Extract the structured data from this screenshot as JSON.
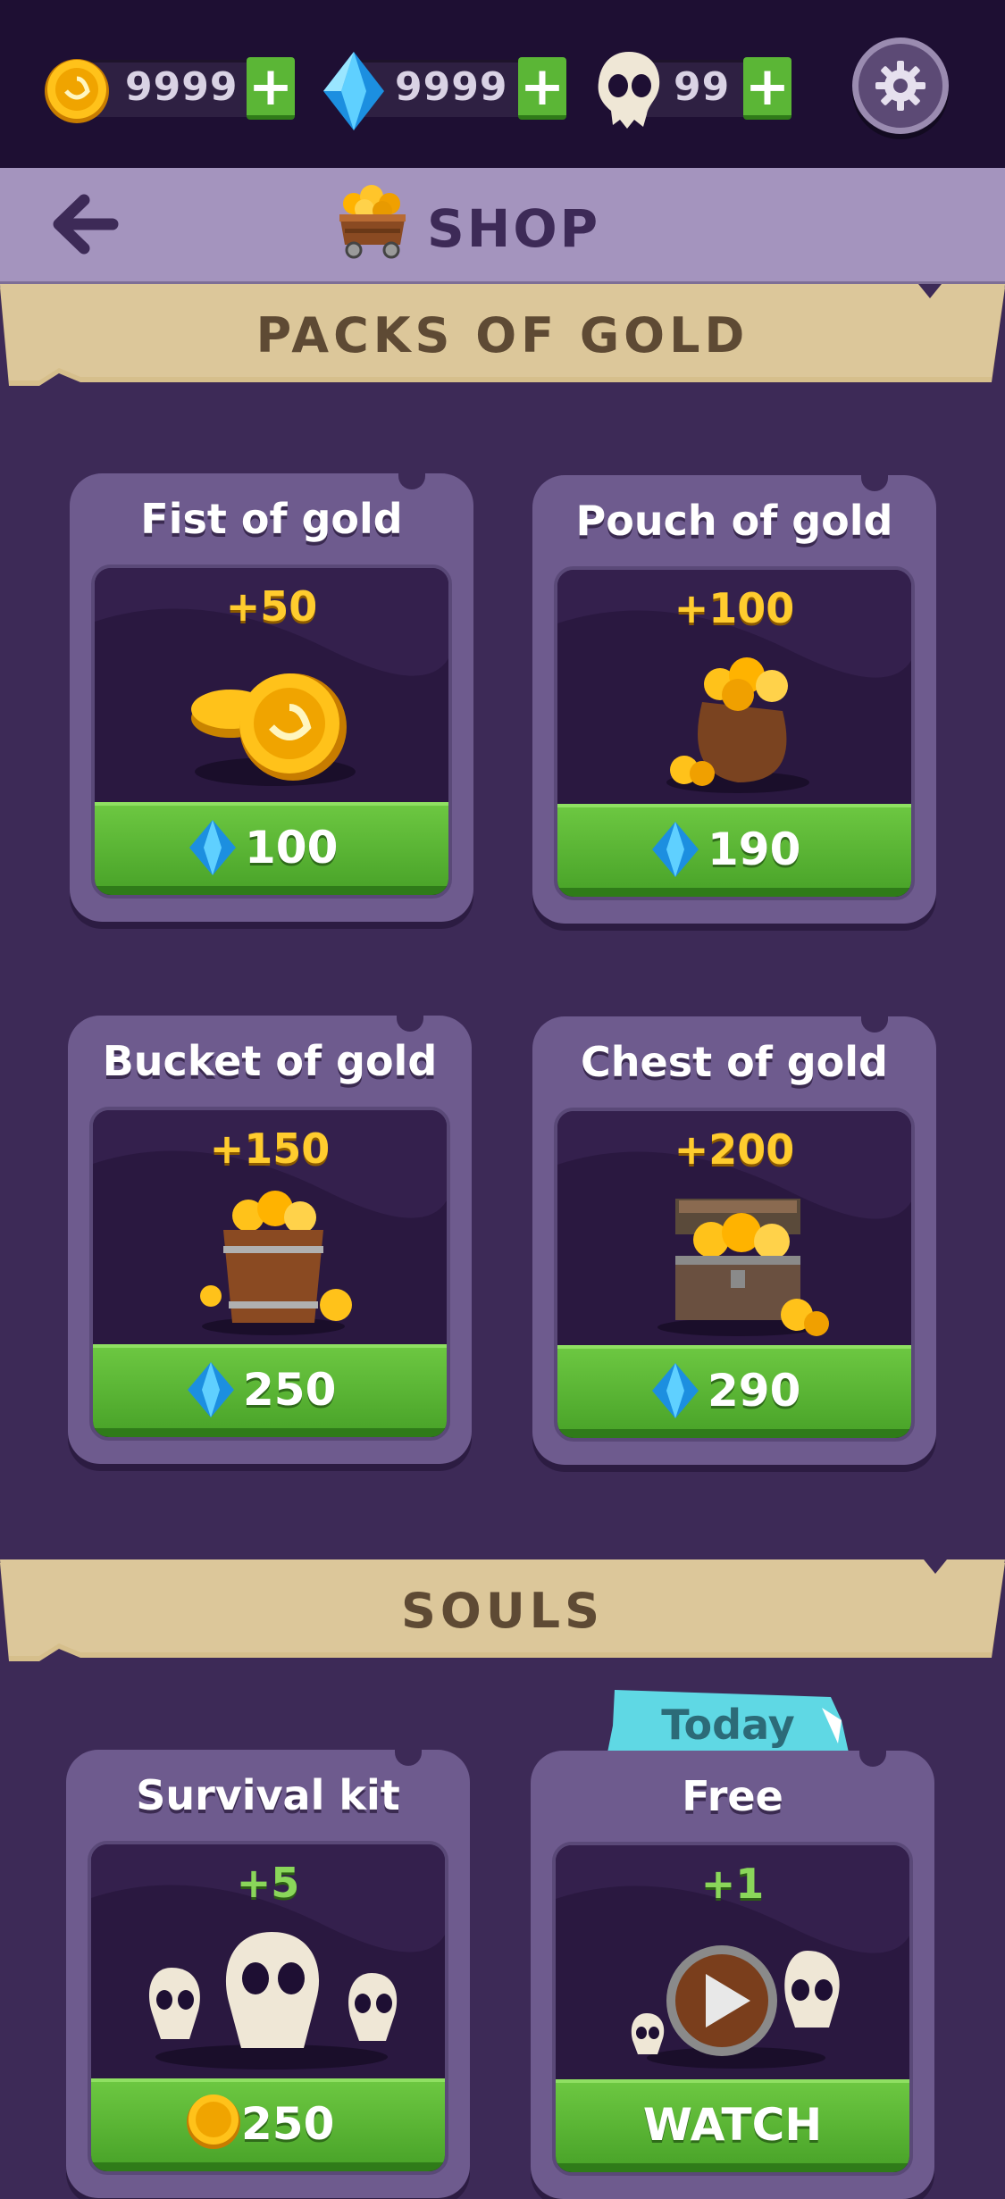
{
  "resources": {
    "gold": {
      "value": "9999",
      "icon": "gold-coin-icon"
    },
    "gems": {
      "value": "9999",
      "icon": "blue-gem-icon"
    },
    "souls": {
      "value": "99",
      "icon": "skull-icon"
    },
    "plus_label": "+"
  },
  "header": {
    "title": "SHOP",
    "back_icon": "back-arrow-icon",
    "shop_icon": "cart-icon"
  },
  "sections": [
    {
      "title": "PACKS OF GOLD",
      "items": [
        {
          "title": "Fist of gold",
          "amount": "+50",
          "price": "100",
          "currency": "gem"
        },
        {
          "title": "Pouch of gold",
          "amount": "+100",
          "price": "190",
          "currency": "gem"
        },
        {
          "title": "Bucket of gold",
          "amount": "+150",
          "price": "250",
          "currency": "gem"
        },
        {
          "title": "Chest of gold",
          "amount": "+200",
          "price": "290",
          "currency": "gem"
        }
      ]
    },
    {
      "title": "SOULS",
      "items": [
        {
          "title": "Survival kit",
          "amount": "+5",
          "price": "250",
          "currency": "gold"
        },
        {
          "title": "Free",
          "amount": "+1",
          "action": "WATCH",
          "badge": "Today"
        }
      ]
    }
  ],
  "colors": {
    "background": "#3d2a57",
    "topbar": "#1e0f33",
    "header": "#a494be",
    "banner": "#dcc79a",
    "button_green": "#5bb636"
  }
}
